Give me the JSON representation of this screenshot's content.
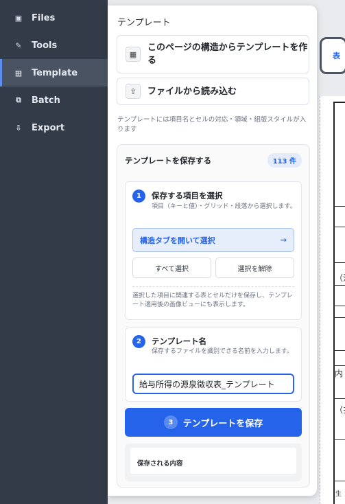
{
  "sidebar": {
    "items": [
      {
        "label": "Files",
        "icon": "square-icon",
        "glyph": "▣"
      },
      {
        "label": "Tools",
        "icon": "pencil-icon",
        "glyph": "✎"
      },
      {
        "label": "Template",
        "icon": "grid-icon",
        "glyph": "▦"
      },
      {
        "label": "Batch",
        "icon": "copy-icon",
        "glyph": "⧉"
      },
      {
        "label": "Export",
        "icon": "download-icon",
        "glyph": "⇩"
      }
    ]
  },
  "canvas": {
    "mode_button": "表",
    "doc_chars": [
      "（注",
      "内",
      "（扌",
      "生"
    ]
  },
  "panel": {
    "title": "テンプレート",
    "create_from_structure": "このページの構造からテンプレートを作る",
    "load_from_file": "ファイルから読み込む",
    "hint": "テンプレートには項目名とセルの対応・領域・組版スタイルが入ります",
    "save_section": {
      "title": "テンプレートを保存する",
      "count": "113 件",
      "step1": {
        "number": "1",
        "title": "保存する項目を選択",
        "desc": "項目（キーと値）・グリッド・段落から選択します。",
        "open_structure_tab": "構造タブを開いて選択",
        "arrow": "→",
        "select_all": "すべて選択",
        "deselect": "選択を解除",
        "note": "選択した項目に関連する表とセルだけを保存し、テンプレート適用後の画像ビューにも表示します。"
      },
      "step2": {
        "number": "2",
        "title": "テンプレート名",
        "desc": "保存するファイルを識別できる名前を入力します。",
        "input_value": "給与所得の源泉徴収表_テンプレート"
      },
      "save_button": {
        "number": "3",
        "label": "テンプレートを保存"
      },
      "saved_contents_label": "保存される内容"
    }
  },
  "colors": {
    "accent": "#2563eb",
    "sidebar": "#333b48"
  }
}
